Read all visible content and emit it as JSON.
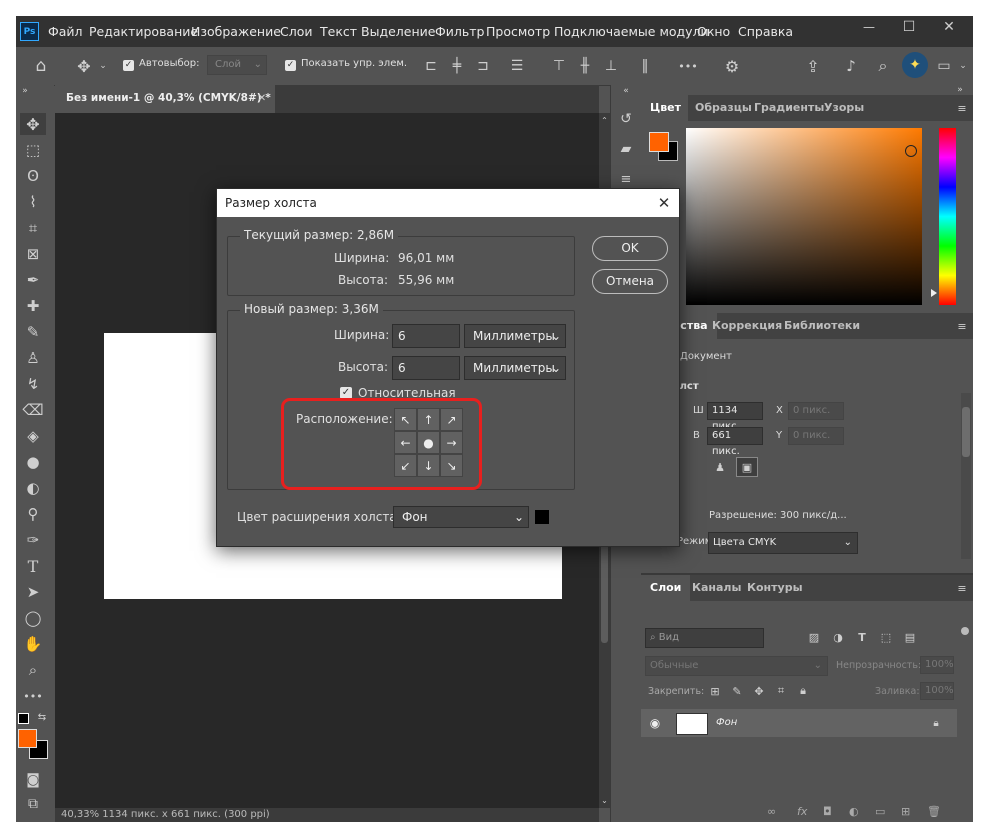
{
  "menu": {
    "logo": "Ps",
    "items": [
      "Файл",
      "Редактирование",
      "Изображение",
      "Слои",
      "Текст",
      "Выделение",
      "Фильтр",
      "Просмотр",
      "Подключаемые модули",
      "Окно",
      "Справка"
    ]
  },
  "window_controls": {
    "minimize": "—",
    "maximize": "☐",
    "close": "✕"
  },
  "options": {
    "autoselect_label": "Автовыбор:",
    "autoselect_value": "Слой",
    "show_controls_label": "Показать упр. элем.",
    "more": "•••"
  },
  "document": {
    "tab_title": "Без имени-1 @ 40,3% (CMYK/8#) *",
    "status": "40,33%   1134 пикс. x 661 пикс. (300 ppi)"
  },
  "color_panel": {
    "tabs": [
      "Цвет",
      "Образцы",
      "Градиенты",
      "Узоры"
    ],
    "fg_color": "#ff6200",
    "bg_color": "#000000"
  },
  "props_panel": {
    "tabs": [
      "Свойства",
      "Коррекция",
      "Библиотеки"
    ],
    "doc_label": "Документ",
    "canvas_heading": "Холст",
    "w_label": "Ш",
    "w_value": "1134 пикс.",
    "h_label": "В",
    "h_value": "661 пикс.",
    "x_label": "X",
    "y_label": "Y",
    "x_placeholder": "0 пикс.",
    "y_placeholder": "0 пикс.",
    "resolution": "Разрешение: 300 пикс/д...",
    "mode_label": "Режим",
    "mode_value": "Цвета CMYK"
  },
  "layers_panel": {
    "tabs": [
      "Слои",
      "Каналы",
      "Контуры"
    ],
    "search_placeholder": "Вид",
    "blend_mode": "Обычные",
    "opacity_label": "Непрозрачность:",
    "opacity_value": "100%",
    "lock_label": "Закрепить:",
    "fill_label": "Заливка:",
    "fill_value": "100%",
    "layer_name": "Фон"
  },
  "dialog": {
    "title": "Размер холста",
    "current_size_title": "Текущий размер:  2,86M",
    "current_width_label": "Ширина:",
    "current_width_value": "96,01 мм",
    "current_height_label": "Высота:",
    "current_height_value": "55,96 мм",
    "new_size_title": "Новый размер: 3,36M",
    "width_label": "Ширина:",
    "width_value": "6",
    "height_label": "Высота:",
    "height_value": "6",
    "unit": "Миллиметры",
    "relative_label": "Относительная",
    "anchor_label": "Расположение:",
    "extension_label": "Цвет расширения холста:",
    "extension_value": "Фон",
    "extension_swatch": "#000000",
    "ok": "OK",
    "cancel": "Отмена",
    "highlight_color": "#e8201e"
  }
}
